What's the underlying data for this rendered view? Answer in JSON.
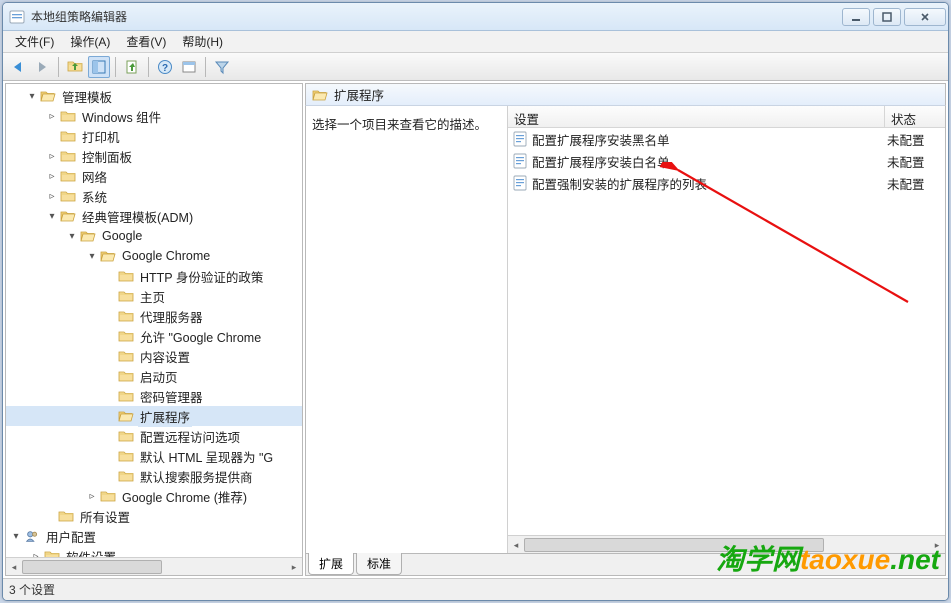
{
  "window": {
    "title": "本地组策略编辑器"
  },
  "menu": {
    "file": "文件(F)",
    "action": "操作(A)",
    "view": "查看(V)",
    "help": "帮助(H)"
  },
  "tree": {
    "admin_templates": "管理模板",
    "windows_components": "Windows 组件",
    "printers": "打印机",
    "control_panel": "控制面板",
    "network": "网络",
    "system": "系统",
    "classic_adm": "经典管理模板(ADM)",
    "google": "Google",
    "google_chrome": "Google Chrome",
    "http_auth": "HTTP 身份验证的政策",
    "homepage": "主页",
    "proxy": "代理服务器",
    "allow_chrome": "允许 \"Google Chrome",
    "content_settings": "内容设置",
    "startup": "启动页",
    "password_mgr": "密码管理器",
    "extensions": "扩展程序",
    "remote_access": "配置远程访问选项",
    "default_html": "默认 HTML 呈现器为 \"G",
    "default_search": "默认搜索服务提供商",
    "chrome_recommended": "Google Chrome (推荐)",
    "all_settings": "所有设置",
    "user_config": "用户配置",
    "software_settings": "软件设置"
  },
  "right": {
    "header": "扩展程序",
    "prompt": "选择一个项目来查看它的描述。",
    "columns": {
      "setting": "设置",
      "status": "状态"
    },
    "rows": [
      {
        "setting": "配置扩展程序安装黑名单",
        "status": "未配置"
      },
      {
        "setting": "配置扩展程序安装白名单",
        "status": "未配置"
      },
      {
        "setting": "配置强制安装的扩展程序的列表",
        "status": "未配置"
      }
    ],
    "tabs": {
      "extended": "扩展",
      "standard": "标准"
    }
  },
  "status": "3 个设置",
  "watermark": {
    "p1": "淘学网",
    "p2": "taoxue",
    "p3": ".net"
  }
}
